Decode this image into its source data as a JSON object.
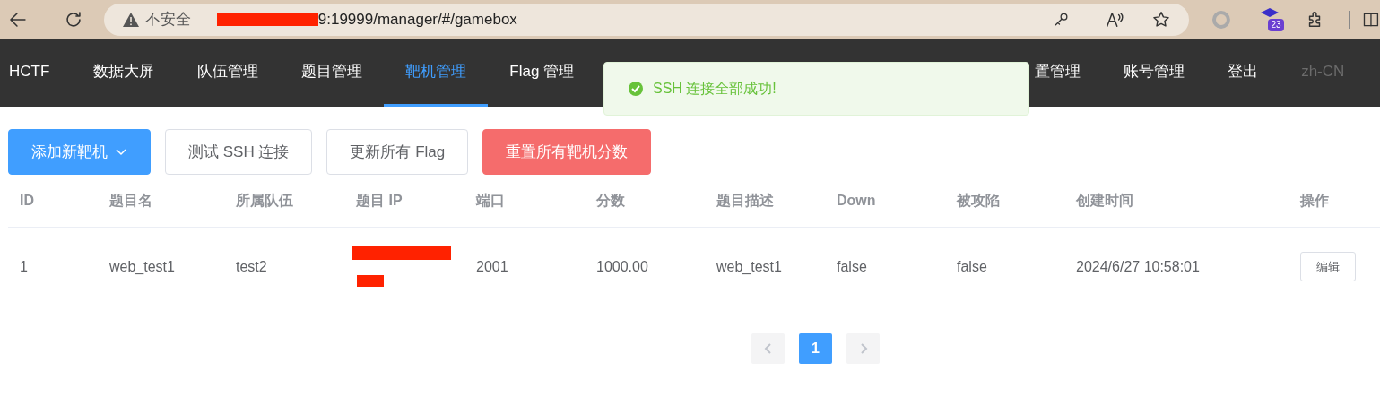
{
  "browser": {
    "security_label": "不安全",
    "host_redacted": true,
    "url": "9:19999/manager/#/gamebox",
    "extension_badge": "23"
  },
  "nav": {
    "brand": "HCTF",
    "items": [
      {
        "label": "数据大屏",
        "selected": false
      },
      {
        "label": "队伍管理",
        "selected": false
      },
      {
        "label": "题目管理",
        "selected": false
      },
      {
        "label": "靶机管理",
        "selected": true
      },
      {
        "label": "Flag 管理",
        "selected": false
      },
      {
        "label": "置管理",
        "selected": false
      },
      {
        "label": "账号管理",
        "selected": false
      },
      {
        "label": "登出",
        "selected": false
      }
    ],
    "language": {
      "label": "zh-CN",
      "disabled": true
    }
  },
  "toast": {
    "kind": "success",
    "message": "SSH 连接全部成功!"
  },
  "toolbar": [
    {
      "label": "添加新靶机",
      "kind": "primary-dropdown"
    },
    {
      "label": "测试 SSH 连接",
      "kind": "plain"
    },
    {
      "label": "更新所有 Flag",
      "kind": "plain"
    },
    {
      "label": "重置所有靶机分数",
      "kind": "danger"
    }
  ],
  "table": {
    "columns": [
      "ID",
      "题目名",
      "所属队伍",
      "题目 IP",
      "端口",
      "分数",
      "题目描述",
      "Down",
      "被攻陷",
      "创建时间",
      "操作"
    ],
    "rows": [
      {
        "id": "1",
        "name": "web_test1",
        "team": "test2",
        "ip_redacted": true,
        "port": "2001",
        "score": "1000.00",
        "description": "web_test1",
        "down": "false",
        "captured": "false",
        "created": "2024/6/27 10:58:01",
        "action": "编辑"
      }
    ]
  },
  "pagination": {
    "pages": [
      {
        "label": "1",
        "selected": true
      }
    ]
  }
}
